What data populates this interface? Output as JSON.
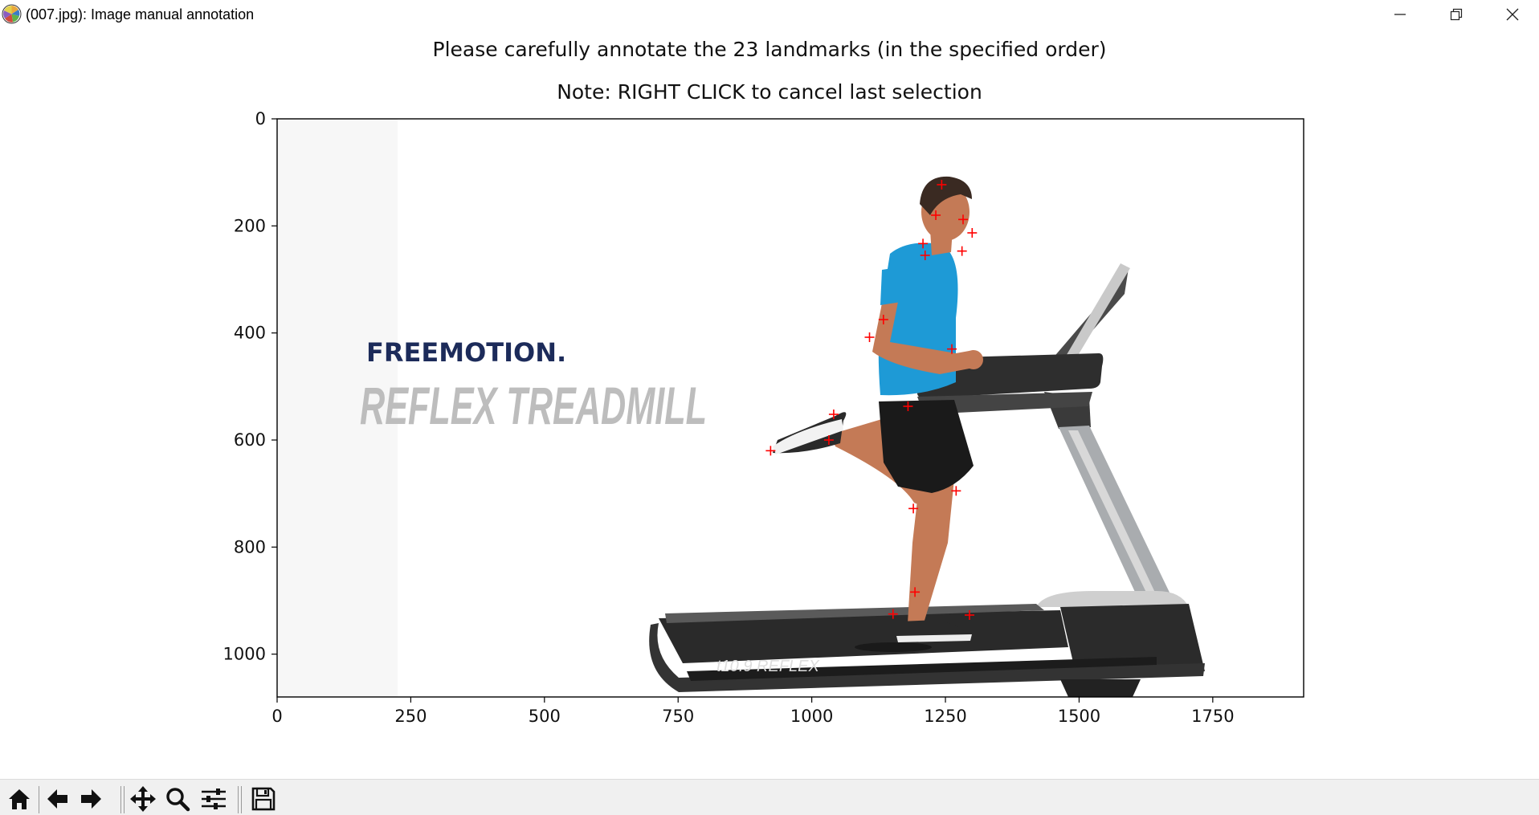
{
  "window": {
    "title": "(007.jpg): Image manual annotation",
    "controls": [
      {
        "name": "minimize-icon",
        "label": "minimize"
      },
      {
        "name": "restore-icon",
        "label": "restore"
      },
      {
        "name": "close-icon",
        "label": "close"
      }
    ]
  },
  "figure": {
    "title_line1": "Please carefully annotate the 23 landmarks (in the specified order)",
    "title_line2": "Note: RIGHT CLICK to cancel last selection"
  },
  "image": {
    "brand_logo": "FREEMOTION.",
    "product_text": "REFLEX TREADMILL",
    "deck_label": "t10.9 REFLEX"
  },
  "colors": {
    "marker": "#ff0000",
    "logo_navy": "#1c2b5a",
    "product_gray": "#bdbdbd",
    "shirt": "#1e9ad6",
    "shorts": "#1a1a1a",
    "skin": "#c47a56",
    "treadmill_dark": "#2b2b2b",
    "treadmill_silver": "#a9acaf",
    "toolbar_bg": "#f0f0f0"
  },
  "chart_data": {
    "type": "scatter",
    "title": "Please carefully annotate the 23 landmarks (in the specified order)",
    "subtitle": "Note: RIGHT CLICK to cancel last selection",
    "xlabel": "",
    "ylabel": "",
    "xlim": [
      0,
      1920
    ],
    "ylim": [
      1080,
      0
    ],
    "x_ticks": [
      0,
      250,
      500,
      750,
      1000,
      1250,
      1500,
      1750
    ],
    "y_ticks": [
      0,
      200,
      400,
      600,
      800,
      1000
    ],
    "grid": false,
    "marker": "+",
    "marker_color": "#ff0000",
    "series": [
      {
        "x": [
          1243,
          1232,
          1283,
          1300,
          1208,
          1212,
          1281,
          1134,
          1108,
          1262,
          1180,
          1041,
          1032,
          923,
          1190,
          1270,
          1193,
          1152,
          1295
        ],
        "y": [
          123,
          180,
          188,
          213,
          233,
          255,
          247,
          375,
          408,
          430,
          537,
          552,
          600,
          620,
          728,
          695,
          884,
          925,
          927
        ]
      }
    ]
  },
  "toolbar": {
    "buttons": [
      {
        "name": "home-icon",
        "label": "Home"
      },
      {
        "name": "back-arrow-icon",
        "label": "Back"
      },
      {
        "name": "forward-arrow-icon",
        "label": "Forward"
      },
      {
        "name": "pan-icon",
        "label": "Pan"
      },
      {
        "name": "zoom-icon",
        "label": "Zoom"
      },
      {
        "name": "configure-subplots-icon",
        "label": "Subplots"
      },
      {
        "name": "save-icon",
        "label": "Save"
      }
    ]
  }
}
